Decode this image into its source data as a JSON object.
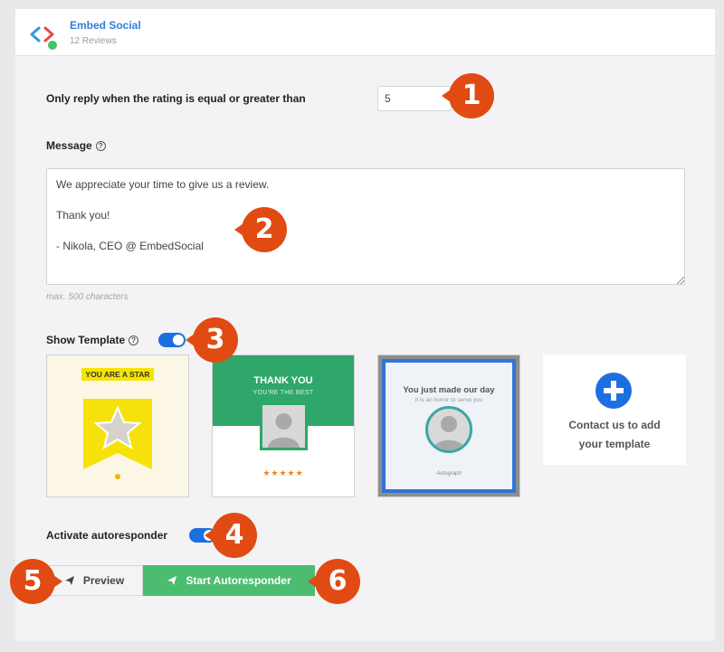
{
  "header": {
    "app_name": "Embed Social",
    "reviews": "12 Reviews"
  },
  "rating": {
    "label": "Only reply when the rating is equal or greater than",
    "value": "5"
  },
  "message": {
    "label": "Message",
    "text": "We appreciate your time to give us a review.\n\nThank you!\n\n- Nikola, CEO @ EmbedSocial",
    "hint": "max. 500 characters"
  },
  "template": {
    "label": "Show Template",
    "enabled": true,
    "cards": [
      {
        "title": "YOU ARE A STAR"
      },
      {
        "title": "THANK YOU",
        "subtitle": "YOU'RE THE BEST",
        "stars": "★★★★★"
      },
      {
        "title": "You just made our day",
        "subtitle": "It is an honor to serve you",
        "signature": "Autograph"
      },
      {
        "title": "Contact us to add\nyour template"
      }
    ]
  },
  "autoresponder": {
    "label": "Activate autoresponder",
    "enabled": true
  },
  "buttons": {
    "preview": "Preview",
    "start": "Start Autoresponder"
  },
  "callouts": [
    "1",
    "2",
    "3",
    "4",
    "5",
    "6"
  ],
  "colors": {
    "accent": "#1c6fe0",
    "green": "#4cbc71",
    "callout": "#e14a12",
    "brand_blue": "#2f7fd8"
  },
  "icons": {
    "logo": "code-brackets-icon",
    "send": "paper-plane-icon",
    "help": "question-circle-icon",
    "add": "plus-circle-icon"
  }
}
